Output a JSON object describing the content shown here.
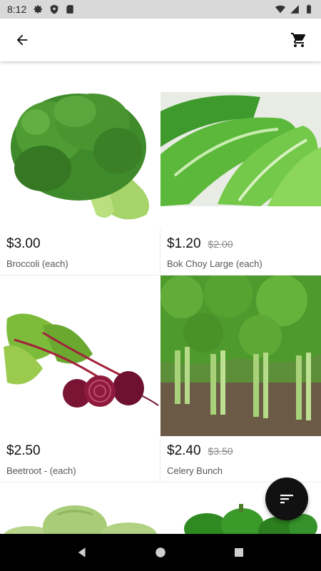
{
  "status_bar": {
    "time": "8:12",
    "left_icons": [
      "gear-icon",
      "shield-icon",
      "sd-card-icon"
    ],
    "right_icons": [
      "wifi-icon",
      "signal-icon",
      "battery-icon"
    ]
  },
  "app_bar": {
    "back_icon": "arrow-left-icon",
    "cart_icon": "shopping-cart-icon"
  },
  "products": [
    {
      "price": "$3.00",
      "old_price": "",
      "name": "Broccoli (each)",
      "image": "broccoli"
    },
    {
      "price": "$1.20",
      "old_price": "$2.00",
      "name": "Bok Choy Large (each)",
      "image": "bok-choy"
    },
    {
      "price": "$2.50",
      "old_price": "",
      "name": "Beetroot - (each)",
      "image": "beetroot"
    },
    {
      "price": "$2.40",
      "old_price": "$3.50",
      "name": "Celery Bunch",
      "image": "celery"
    },
    {
      "price": "",
      "old_price": "",
      "name": "",
      "image": "cabbage"
    },
    {
      "price": "",
      "old_price": "",
      "name": "",
      "image": "green-pepper"
    }
  ],
  "fab": {
    "icon": "sort-icon"
  },
  "nav_bar": {
    "icons": [
      "back-triangle-icon",
      "home-circle-icon",
      "recents-square-icon"
    ]
  },
  "colors": {
    "status_bar_bg": "#d9d9d9",
    "fab_bg": "#111111",
    "nav_bg": "#000000"
  }
}
